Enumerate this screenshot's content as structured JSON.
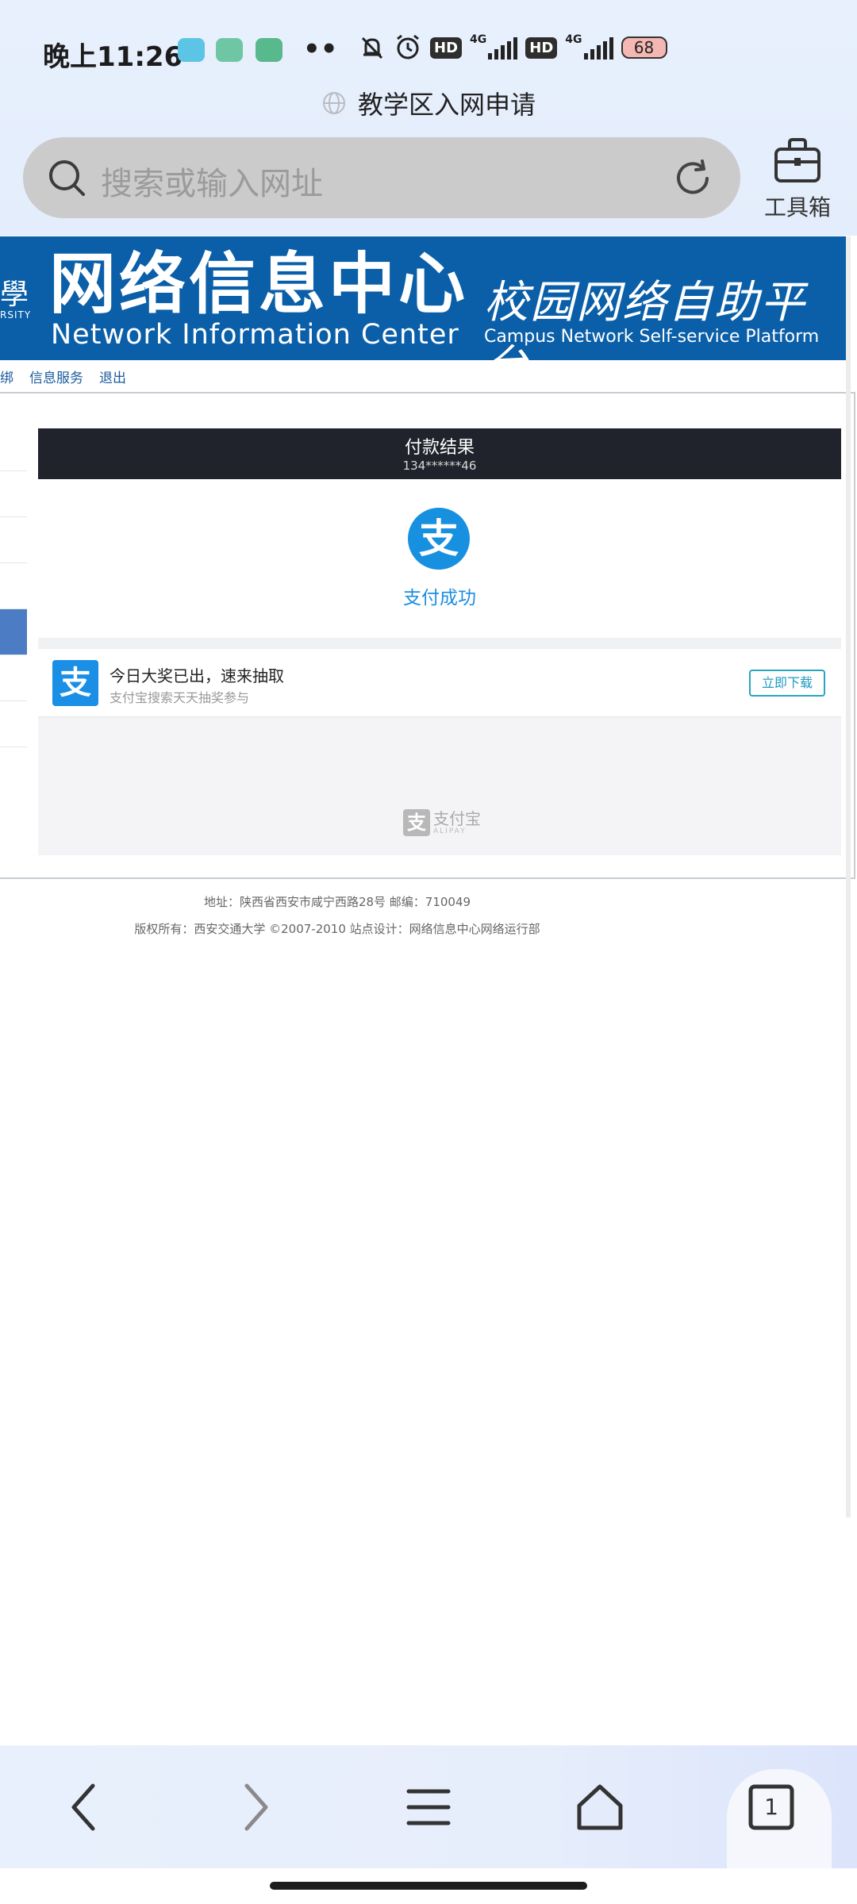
{
  "status_bar": {
    "time": "晚上11:26",
    "dots": "••",
    "hd1": "HD",
    "net1": "4G",
    "hd2": "HD",
    "net2": "4G",
    "battery": "68"
  },
  "browser": {
    "page_title": "教学区入网申请",
    "address_placeholder": "搜索或输入网址",
    "toolbox_label": "工具箱",
    "tabs_count": "1"
  },
  "banner": {
    "university_glyph": "學",
    "university_sub": "RSITY",
    "title_cn": "网络信息中心",
    "title_en": "Network Information Center",
    "platform_cn": "校园网络自助平台",
    "platform_en": "Campus Network Self-service Platform"
  },
  "subnav": {
    "items": [
      "绑",
      "信息服务",
      "退出"
    ]
  },
  "payment": {
    "title": "付款结果",
    "account": "134******46",
    "status": "支付成功",
    "alipay_glyph": "支"
  },
  "ad": {
    "title": "今日大奖已出，速来抽取",
    "subtitle": "支付宝搜索天天抽奖参与",
    "button": "立即下载",
    "logo_glyph": "支"
  },
  "brand": {
    "name": "支付宝",
    "name_en": "ALIPAY",
    "glyph": "支"
  },
  "footer": {
    "address": "地址：陕西省西安市咸宁西路28号 邮编：710049",
    "copyright": "版权所有：西安交通大学 ©2007-2010 站点设计：网络信息中心网络运行部"
  },
  "colors": {
    "banner_blue": "#0a5fa8",
    "alipay_blue": "#1890e0",
    "payment_header": "#20232b",
    "menu_active": "#4c7dc4"
  }
}
